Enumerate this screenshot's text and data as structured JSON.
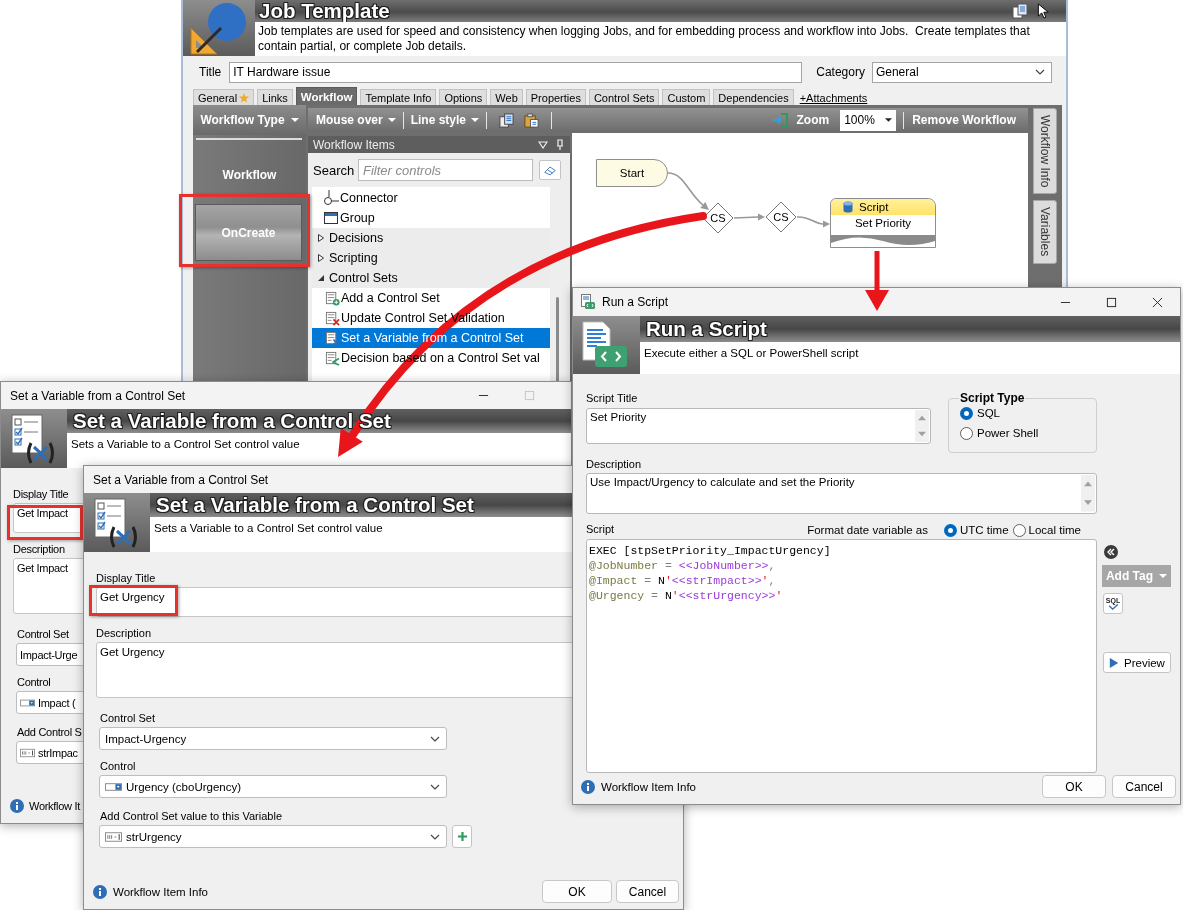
{
  "main_window": {
    "title": "Job Template",
    "description": "Job templates are used for speed and consistency when logging Jobs, and for embedding process and workflow into Jobs.  Create templates that contain partial, or complete Job details.",
    "title_field": {
      "label": "Title",
      "value": "IT Hardware issue"
    },
    "category_field": {
      "label": "Category",
      "value": "General"
    },
    "tabs": [
      {
        "kind": "tab",
        "label": "General",
        "selected": false,
        "starred": true
      },
      {
        "kind": "tab",
        "label": "Links",
        "selected": false,
        "starred": false
      },
      {
        "kind": "tab",
        "label": "Workflow",
        "selected": true,
        "starred": false
      },
      {
        "kind": "tab",
        "label": "Template Info",
        "selected": false,
        "starred": false
      },
      {
        "kind": "tab",
        "label": "Options",
        "selected": false,
        "starred": false
      },
      {
        "kind": "tab",
        "label": "Web",
        "selected": false,
        "starred": false
      },
      {
        "kind": "tab",
        "label": "Properties",
        "selected": false,
        "starred": false
      },
      {
        "kind": "tab",
        "label": "Control Sets",
        "selected": false,
        "starred": false
      },
      {
        "kind": "tab",
        "label": "Custom",
        "selected": false,
        "starred": false
      },
      {
        "kind": "tab",
        "label": "Dependencies",
        "selected": false,
        "starred": false
      },
      {
        "kind": "link",
        "label": "+Attachments"
      }
    ],
    "workflow_type": {
      "label": "Workflow Type",
      "items": [
        {
          "label": "Workflow",
          "selected": false,
          "highlighted": false
        },
        {
          "label": "OnCreate",
          "selected": true,
          "highlighted": true
        }
      ]
    },
    "toolbar": {
      "menus": [
        "Mouse over",
        "Line style"
      ],
      "zoom_label": "Zoom",
      "zoom_value": "100%",
      "remove_label": "Remove Workflow"
    },
    "workflow_items": {
      "title": "Workflow Items",
      "search_label": "Search",
      "search_placeholder": "Filter controls",
      "items": [
        {
          "kind": "item",
          "label": "Connector",
          "selected": false
        },
        {
          "kind": "item",
          "label": "Group",
          "selected": false
        },
        {
          "kind": "category",
          "label": "Decisions",
          "selected": false,
          "expanded": false
        },
        {
          "kind": "category",
          "label": "Scripting",
          "selected": false,
          "expanded": false
        },
        {
          "kind": "category",
          "label": "Control Sets",
          "selected": false,
          "expanded": true,
          "children": [
            {
              "label": "Add a Control Set",
              "selected": false
            },
            {
              "label": "Update Control Set Validation",
              "selected": false
            },
            {
              "label": "Set a Variable from a Control Set",
              "selected": true
            },
            {
              "label": "Decision based on a Control Set val",
              "selected": false
            }
          ]
        }
      ]
    },
    "canvas": {
      "nodes": [
        {
          "kind": "start",
          "label": "Start"
        },
        {
          "kind": "decision",
          "label": "CS"
        },
        {
          "kind": "decision",
          "label": "CS"
        },
        {
          "kind": "script",
          "header": "Script",
          "label": "Set Priority"
        }
      ]
    },
    "side_tabs": [
      "Workflow Info",
      "Variables"
    ]
  },
  "back_dialog": {
    "window_title": "Set a Variable from a Control Set",
    "heading": "Set a Variable from a Control Set",
    "subtitle": "Sets a Variable to a Control Set control value",
    "fields": [
      {
        "kind": "text",
        "label": "Display Title",
        "value": "Get Impact",
        "highlighted": true
      },
      {
        "kind": "textarea",
        "label": "Description",
        "value": "Get Impact",
        "highlighted": false
      },
      {
        "kind": "select",
        "label": "Control Set",
        "value": "Impact-Urge",
        "highlighted": false
      },
      {
        "kind": "control-select",
        "label": "Control",
        "value": "Impact (",
        "highlighted": false
      },
      {
        "kind": "variable-select",
        "label": "Add Control S",
        "value": "strImpac",
        "highlighted": false
      }
    ],
    "info_label": "Workflow It"
  },
  "front_dialog": {
    "window_title": "Set a Variable from a Control Set",
    "heading": "Set a Variable from a Control Set",
    "subtitle": "Sets a Variable to a Control Set control value",
    "fields": [
      {
        "kind": "text",
        "label": "Display Title",
        "value": "Get Urgency",
        "highlighted": true
      },
      {
        "kind": "textarea",
        "label": "Description",
        "value": "Get Urgency",
        "highlighted": false
      },
      {
        "kind": "select",
        "label": "Control Set",
        "value": "Impact-Urgency",
        "highlighted": false
      },
      {
        "kind": "control-select",
        "label": "Control",
        "value": "Urgency (cboUrgency)",
        "highlighted": false
      },
      {
        "kind": "variable-select",
        "label": "Add Control Set value to this Variable",
        "value": "strUrgency",
        "highlighted": false,
        "add_button": true
      }
    ],
    "info_label": "Workflow Item Info",
    "buttons": [
      "OK",
      "Cancel"
    ]
  },
  "script_dialog": {
    "window_title": "Run a Script",
    "heading": "Run a Script",
    "subtitle": "Execute either a SQL or PowerShell script",
    "script_title": {
      "label": "Script Title",
      "value": "Set Priority"
    },
    "script_type": {
      "label": "Script Type",
      "options": [
        {
          "label": "SQL",
          "selected": true
        },
        {
          "label": "Power Shell",
          "selected": false
        }
      ]
    },
    "description": {
      "label": "Description",
      "value": "Use Impact/Urgency to calculate and set the Priority"
    },
    "script_label": "Script",
    "date_format": {
      "label": "Format date variable as",
      "options": [
        {
          "label": "UTC time",
          "selected": true
        },
        {
          "label": "Local time",
          "selected": false
        }
      ]
    },
    "lines": [
      [
        {
          "kind": "plain",
          "text": "EXEC [stpSetPriority_ImpactUrgency]"
        }
      ],
      [
        {
          "kind": "param",
          "text": "@JobNumber"
        },
        {
          "kind": "op",
          "text": " = "
        },
        {
          "kind": "tag",
          "text": "<<JobNumber>>"
        },
        {
          "kind": "op",
          "text": ","
        }
      ],
      [
        {
          "kind": "param",
          "text": "@Impact"
        },
        {
          "kind": "op",
          "text": " = "
        },
        {
          "kind": "plain",
          "text": "N"
        },
        {
          "kind": "string",
          "text": "'"
        },
        {
          "kind": "tag",
          "text": "<<strImpact>>"
        },
        {
          "kind": "string",
          "text": "'"
        },
        {
          "kind": "op",
          "text": ","
        }
      ],
      [
        {
          "kind": "param",
          "text": "@Urgency"
        },
        {
          "kind": "op",
          "text": " = "
        },
        {
          "kind": "plain",
          "text": "N"
        },
        {
          "kind": "string",
          "text": "'"
        },
        {
          "kind": "tag",
          "text": "<<strUrgency>>"
        },
        {
          "kind": "string",
          "text": "'"
        }
      ]
    ],
    "add_tag_label": "Add Tag",
    "sql_check_label": "SQL",
    "preview_label": "Preview",
    "info_label": "Workflow Item Info",
    "buttons": [
      "OK",
      "Cancel"
    ]
  }
}
